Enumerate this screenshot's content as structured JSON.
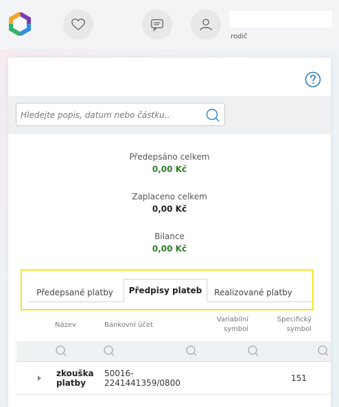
{
  "header": {
    "role": "rodič"
  },
  "search": {
    "placeholder": "Hledejte popis, datum nebo částku.."
  },
  "summary": {
    "prescribed_label": "Předepsáno celkem",
    "prescribed_value": "0,00 Kč",
    "paid_label": "Zaplaceno celkem",
    "paid_value": "0,00 Kč",
    "balance_label": "Bilance",
    "balance_value": "0,00 Kč"
  },
  "tabs": [
    {
      "label": "Předepsané platby",
      "active": false
    },
    {
      "label": "Předpisy plateb",
      "active": true
    },
    {
      "label": "Realizované platby",
      "active": false
    }
  ],
  "table": {
    "columns": {
      "name": "Název",
      "account": "Bankovní účet",
      "variable_1": "Variabilní",
      "variable_2": "symbol",
      "specific_1": "Specifický",
      "specific_2": "symbol"
    },
    "rows": [
      {
        "name_1": "zkouška",
        "name_2": "platby",
        "account_1": "50016-",
        "account_2": "2241441359/0800",
        "variable": "",
        "specific": "151"
      }
    ]
  },
  "colors": {
    "accent_green": "#2f7d2a",
    "highlight_yellow": "#f2ea1a"
  }
}
